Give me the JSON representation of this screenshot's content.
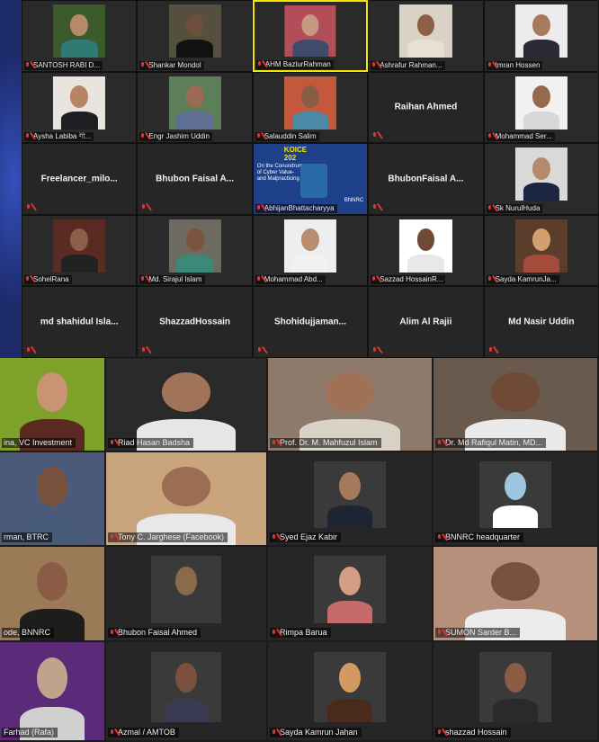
{
  "top_grid": [
    {
      "name": "SANTOSH RABI D...",
      "kind": "video",
      "bg": "#3c5a2c",
      "skin": "#b58a6a",
      "shirt": "#2f7b74"
    },
    {
      "name": "Shankar Mondol",
      "kind": "video",
      "bg": "#55503e",
      "skin": "#6b4f3a",
      "shirt": "#111111"
    },
    {
      "name": "AHM BazlurRahman",
      "kind": "video",
      "active": true,
      "bg": "#b24e5a",
      "skin": "#c59a80",
      "shirt": "#404a6a"
    },
    {
      "name": "Ashrafur Rahman...",
      "kind": "video",
      "bg": "#d9d2c6",
      "skin": "#8c6048",
      "shirt": "#e7e1d4"
    },
    {
      "name": "Imran Hossen",
      "kind": "video",
      "bg": "#ececec",
      "skin": "#a77a5e",
      "shirt": "#2a2a36"
    },
    {
      "name": "Aysha Labiba ণী...",
      "kind": "video",
      "bg": "#e9e4dd",
      "skin": "#b78566",
      "shirt": "#1e1e22"
    },
    {
      "name": "Engr Jashim Uddin",
      "kind": "video",
      "bg": "#5d7e5b",
      "skin": "#9a6b52",
      "shirt": "#5e6e94"
    },
    {
      "name": "Salauddin Salim",
      "kind": "video",
      "bg": "#c3583c",
      "skin": "#8a5c45",
      "shirt": "#4b89a7"
    },
    {
      "name": "Raihan Ahmed",
      "kind": "name"
    },
    {
      "name": "Mohammad Ser...",
      "kind": "video",
      "bg": "#f1f1f1",
      "skin": "#96694f",
      "shirt": "#d8d8d8"
    },
    {
      "name": "Freelancer_milo...",
      "kind": "name"
    },
    {
      "name": "Bhubon Faisal A...",
      "kind": "name"
    },
    {
      "name": "AbhijanBhattacharyya",
      "kind": "poster"
    },
    {
      "name": "BhubonFaisal A...",
      "kind": "name"
    },
    {
      "name": "Sk NurulHuda",
      "kind": "video",
      "bg": "#d9d9d9",
      "skin": "#b38a6c",
      "shirt": "#1b2440"
    },
    {
      "name": "SohelRana",
      "kind": "video",
      "bg": "#5a2b22",
      "skin": "#8a6049",
      "shirt": "#222222"
    },
    {
      "name": "Md. Sirajul Islam",
      "kind": "video",
      "bg": "#6d6a61",
      "skin": "#7b533e",
      "shirt": "#3b8a78"
    },
    {
      "name": "Mohammad Abd...",
      "kind": "video",
      "bg": "#eeeeee",
      "skin": "#b88d70",
      "shirt": "#f1f1f1"
    },
    {
      "name": "Sazzad HossainR...",
      "kind": "video",
      "bg": "#ffffff",
      "skin": "#6f4a36",
      "shirt": "#e8e8e8"
    },
    {
      "name": "Sayda KamrunJa...",
      "kind": "video",
      "bg": "#5a3d2a",
      "skin": "#d2a070",
      "shirt": "#a44c3c"
    },
    {
      "name": "md shahidul Isla...",
      "kind": "name"
    },
    {
      "name": "ShazzadHossain",
      "kind": "name"
    },
    {
      "name": "Shohidujjaman...",
      "kind": "name"
    },
    {
      "name": "Alim Al Rajii",
      "kind": "name"
    },
    {
      "name": "Md Nasir Uddin",
      "kind": "name"
    }
  ],
  "bottom_grid": [
    {
      "name": "ina, VC Investment",
      "bg": "#7ea12a",
      "skin": "#c99474",
      "shirt": "#5a2a22"
    },
    {
      "name": "Riad Hasan Badsha",
      "bg": "#2a2a2a",
      "skin": "#a17358",
      "shirt": "#e6e6e6"
    },
    {
      "name": "Prof. Dr. M. Mahfuzul Islam",
      "bg": "#8d7a6b",
      "skin": "#9f7157",
      "shirt": "#d9d2c6"
    },
    {
      "name": "Dr. Md Rafiqul Matin, MD...",
      "bg": "#6a5a4d",
      "skin": "#6f4a36",
      "shirt": "#eaeaea"
    },
    {
      "name": "rman, BTRC",
      "bg": "#4a5a78",
      "skin": "#7a513c",
      "shirt": "#485a7a"
    },
    {
      "name": "Tony C. Jarghese (Facebook)",
      "bg": "#c9a47c",
      "skin": "#9b6d52",
      "shirt": "#e8e8e8"
    },
    {
      "name": "Syed Ejaz Kabir",
      "bg": "#262626",
      "skin": "#a6785c",
      "shirt": "#1d2432"
    },
    {
      "name": "BNNRC headquarter",
      "bg": "#262626",
      "skin": "#9fc6e0",
      "shirt": "#ffffff"
    },
    {
      "name": "ode, BNNRC",
      "bg": "#9b7a58",
      "skin": "#8a5c45",
      "shirt": "#1d1d1d"
    },
    {
      "name": "Bhubon Faisal Ahmed",
      "bg": "#262626",
      "skin": "#8a6a4a",
      "shirt": "#3a3a3a"
    },
    {
      "name": "Rimpa Barua",
      "bg": "#262626",
      "skin": "#d49d84",
      "shirt": "#c56b6b"
    },
    {
      "name": "SUMON Sarder B...",
      "bg": "#b78f7b",
      "skin": "#7a513c",
      "shirt": "#ececec"
    },
    {
      "name": "Farhad (Rafa)",
      "bg": "#5b2a78",
      "skin": "#bfa38d",
      "shirt": "#d0d0d0"
    },
    {
      "name": "Azmal / AMTOB",
      "bg": "#262626",
      "skin": "#7a513c",
      "shirt": "#3a3a52"
    },
    {
      "name": "Sayda Kamrun Jahan",
      "bg": "#262626",
      "skin": "#d29a60",
      "shirt": "#4a2a1a"
    },
    {
      "name": "shazzad Hossain",
      "bg": "#262626",
      "skin": "#8a5c45",
      "shirt": "#2a2a2a"
    }
  ],
  "poster": {
    "brand": "KOICE",
    "year": "202",
    "line1": "On the Conundrum",
    "line2": "of Cyber Value-",
    "line3": "and Malpracticing",
    "logo": "BNNRC"
  }
}
